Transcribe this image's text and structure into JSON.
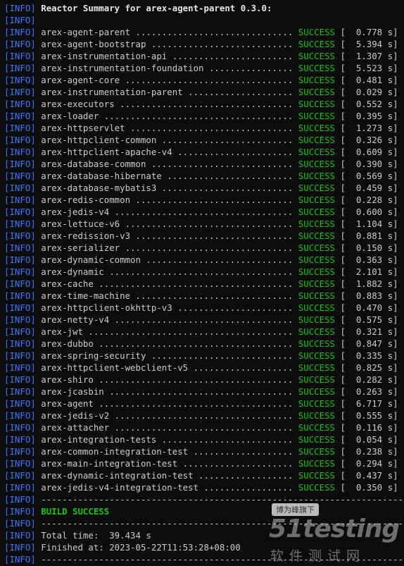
{
  "tag": "[INFO]",
  "header": "Reactor Summary for arex-agent-parent 0.3.0:",
  "modules": [
    {
      "dots": "arex-agent-parent ..............................",
      "status": "SUCCESS",
      "time": "[  0.778 s]"
    },
    {
      "dots": "arex-agent-bootstrap ...........................",
      "status": "SUCCESS",
      "time": "[  5.394 s]"
    },
    {
      "dots": "arex-instrumentation-api .......................",
      "status": "SUCCESS",
      "time": "[  1.307 s]"
    },
    {
      "dots": "arex-instrumentation-foundation ................",
      "status": "SUCCESS",
      "time": "[  5.523 s]"
    },
    {
      "dots": "arex-agent-core ................................",
      "status": "SUCCESS",
      "time": "[  0.481 s]"
    },
    {
      "dots": "arex-instrumentation-parent ....................",
      "status": "SUCCESS",
      "time": "[  0.029 s]"
    },
    {
      "dots": "arex-executors .................................",
      "status": "SUCCESS",
      "time": "[  0.552 s]"
    },
    {
      "dots": "arex-loader ....................................",
      "status": "SUCCESS",
      "time": "[  0.395 s]"
    },
    {
      "dots": "arex-httpservlet ...............................",
      "status": "SUCCESS",
      "time": "[  1.273 s]"
    },
    {
      "dots": "arex-httpclient-common .........................",
      "status": "SUCCESS",
      "time": "[  0.326 s]"
    },
    {
      "dots": "arex-httpclient-apache-v4 ......................",
      "status": "SUCCESS",
      "time": "[  0.609 s]"
    },
    {
      "dots": "arex-database-common ...........................",
      "status": "SUCCESS",
      "time": "[  0.390 s]"
    },
    {
      "dots": "arex-database-hibernate ........................",
      "status": "SUCCESS",
      "time": "[  0.569 s]"
    },
    {
      "dots": "arex-database-mybatis3 .........................",
      "status": "SUCCESS",
      "time": "[  0.459 s]"
    },
    {
      "dots": "arex-redis-common ..............................",
      "status": "SUCCESS",
      "time": "[  0.228 s]"
    },
    {
      "dots": "arex-jedis-v4 ..................................",
      "status": "SUCCESS",
      "time": "[  0.600 s]"
    },
    {
      "dots": "arex-lettuce-v6 ................................",
      "status": "SUCCESS",
      "time": "[  1.104 s]"
    },
    {
      "dots": "arex-redission-v3 ..............................",
      "status": "SUCCESS",
      "time": "[  0.881 s]"
    },
    {
      "dots": "arex-serializer ................................",
      "status": "SUCCESS",
      "time": "[  0.150 s]"
    },
    {
      "dots": "arex-dynamic-common ............................",
      "status": "SUCCESS",
      "time": "[  0.363 s]"
    },
    {
      "dots": "arex-dynamic ...................................",
      "status": "SUCCESS",
      "time": "[  2.101 s]"
    },
    {
      "dots": "arex-cache .....................................",
      "status": "SUCCESS",
      "time": "[  1.882 s]"
    },
    {
      "dots": "arex-time-machine ..............................",
      "status": "SUCCESS",
      "time": "[  0.883 s]"
    },
    {
      "dots": "arex-httpclient-okhttp-v3 ......................",
      "status": "SUCCESS",
      "time": "[  0.470 s]"
    },
    {
      "dots": "arex-netty-v4 ..................................",
      "status": "SUCCESS",
      "time": "[  0.575 s]"
    },
    {
      "dots": "arex-jwt .......................................",
      "status": "SUCCESS",
      "time": "[  0.321 s]"
    },
    {
      "dots": "arex-dubbo .....................................",
      "status": "SUCCESS",
      "time": "[  0.847 s]"
    },
    {
      "dots": "arex-spring-security ...........................",
      "status": "SUCCESS",
      "time": "[  0.335 s]"
    },
    {
      "dots": "arex-httpclient-webclient-v5 ...................",
      "status": "SUCCESS",
      "time": "[  0.825 s]"
    },
    {
      "dots": "arex-shiro .....................................",
      "status": "SUCCESS",
      "time": "[  0.282 s]"
    },
    {
      "dots": "arex-jcasbin ...................................",
      "status": "SUCCESS",
      "time": "[  0.263 s]"
    },
    {
      "dots": "arex-agent .....................................",
      "status": "SUCCESS",
      "time": "[  6.717 s]"
    },
    {
      "dots": "arex-jedis-v2 ..................................",
      "status": "SUCCESS",
      "time": "[  0.555 s]"
    },
    {
      "dots": "arex-attacher ..................................",
      "status": "SUCCESS",
      "time": "[  0.116 s]"
    },
    {
      "dots": "arex-integration-tests .........................",
      "status": "SUCCESS",
      "time": "[  0.054 s]"
    },
    {
      "dots": "arex-common-integration-test ...................",
      "status": "SUCCESS",
      "time": "[  0.238 s]"
    },
    {
      "dots": "arex-main-integration-test .....................",
      "status": "SUCCESS",
      "time": "[  0.294 s]"
    },
    {
      "dots": "arex-dynamic-integration-test ..................",
      "status": "SUCCESS",
      "time": "[  0.437 s]"
    },
    {
      "dots": "arex-jedis-v4-integration-test .................",
      "status": "SUCCESS",
      "time": "[  0.350 s]"
    }
  ],
  "separator": "------------------------------------------------------------------------",
  "build_status": "BUILD SUCCESS",
  "total_time": "Total time:  39.434 s",
  "finished_at": "Finished at: 2023-05-22T11:53:28+08:00",
  "watermark": {
    "top": "博为峰旗下",
    "logo": "51testing",
    "bottom": "软件测试网"
  },
  "colors": {
    "background": "#0c0c0c",
    "info_tag": "#3b78ff",
    "success": "#16c60c",
    "text": "#cccccc"
  }
}
